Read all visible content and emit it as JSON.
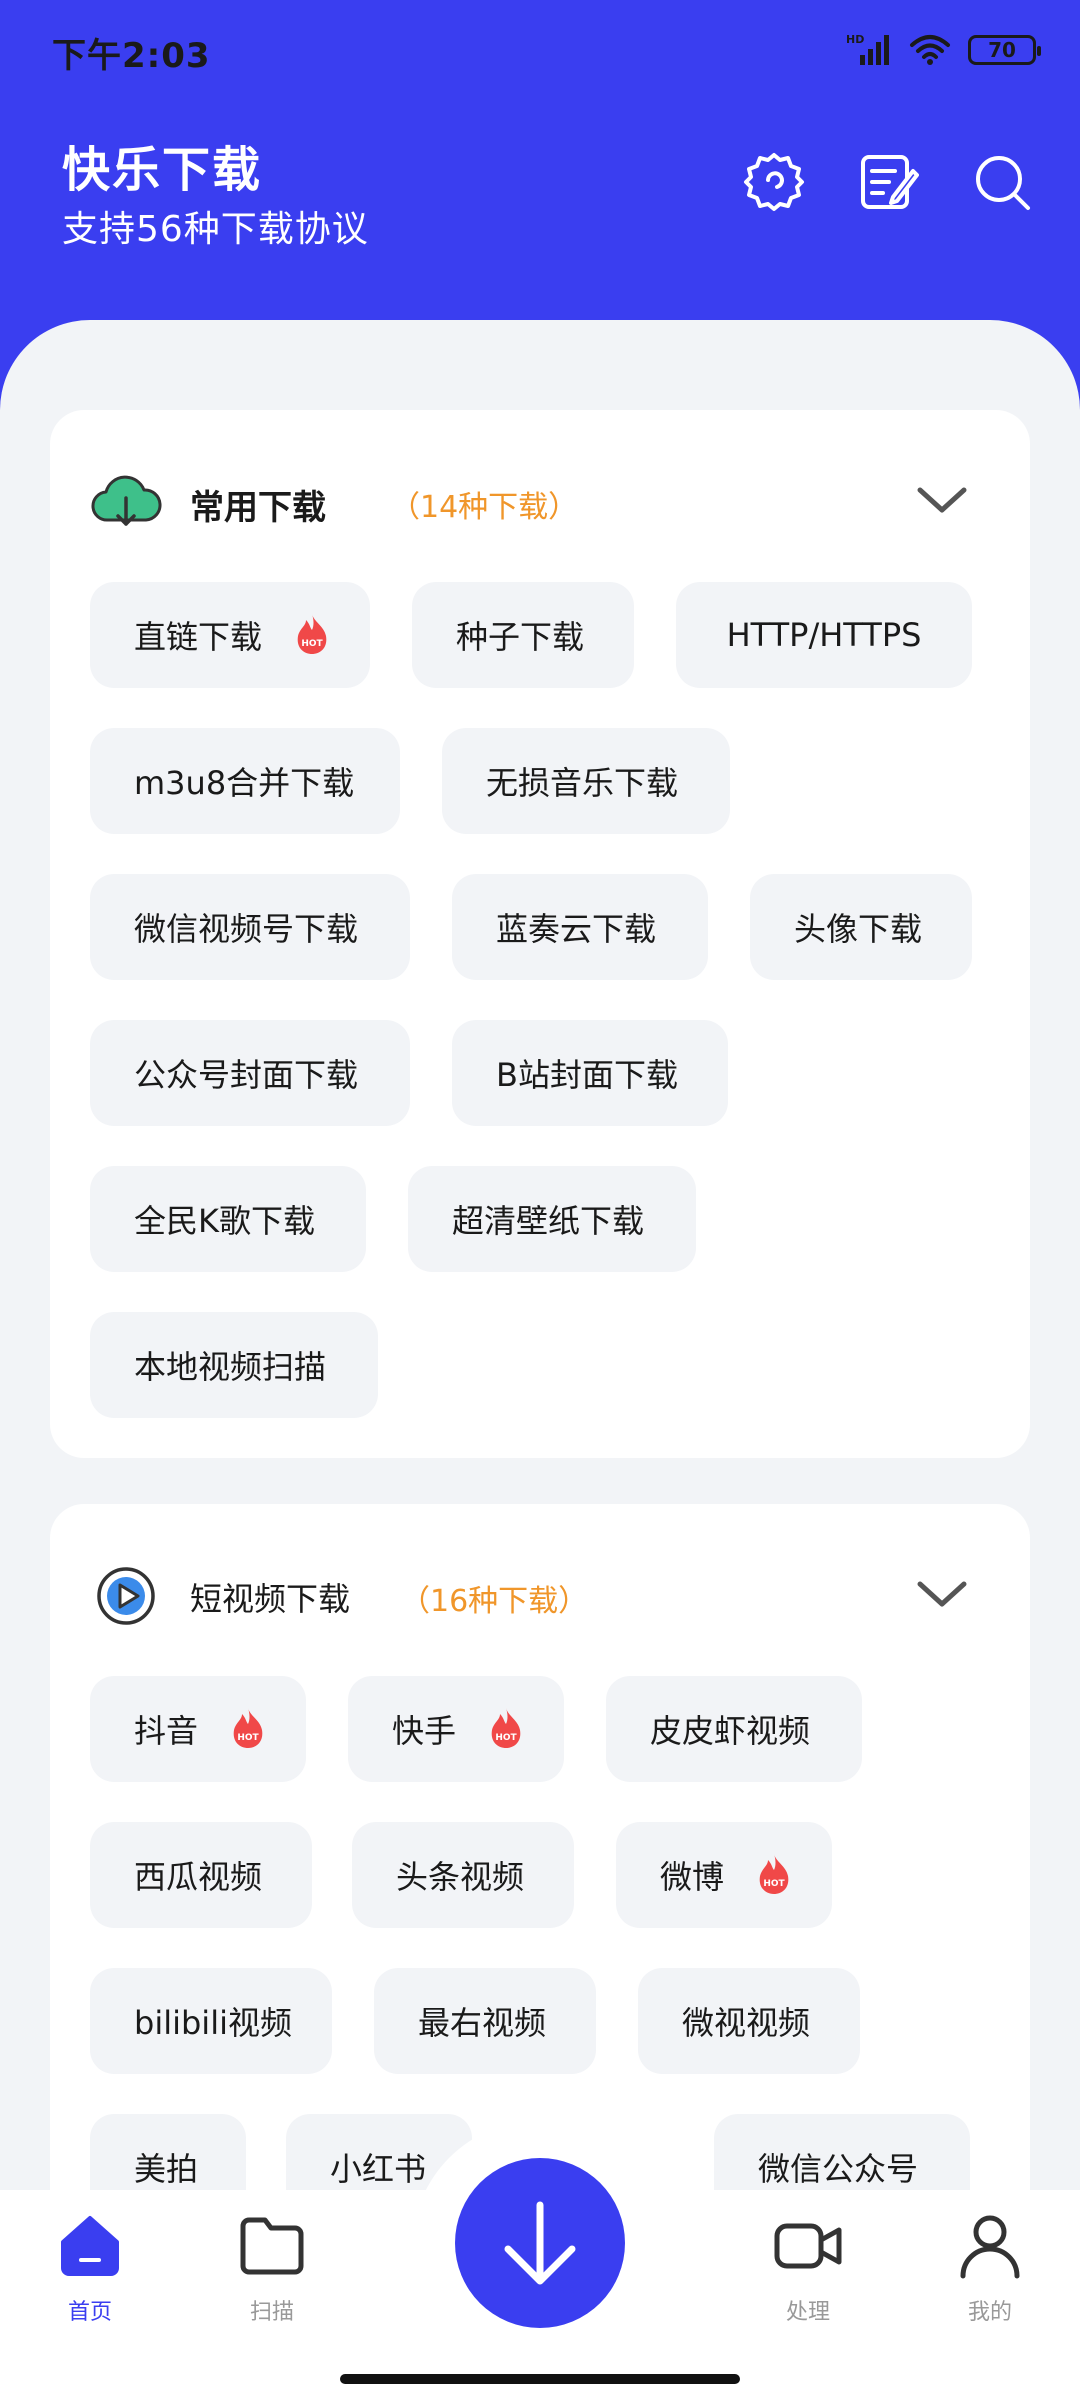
{
  "status": {
    "time": "下午2:03",
    "battery": "70",
    "network": "HD"
  },
  "header": {
    "title": "快乐下载",
    "subtitle": "支持56种下载协议"
  },
  "colors": {
    "brand": "#3a3ef0",
    "accent": "#f0962a",
    "chip_bg": "#f2f4f7",
    "hot": "#f04848"
  },
  "sections": [
    {
      "title": "常用下载",
      "count": "（14种下载）",
      "items": [
        {
          "label": "直链下载",
          "hot": true
        },
        {
          "label": "种子下载",
          "hot": false
        },
        {
          "label": "HTTP/HTTPS",
          "hot": false
        },
        {
          "label": "m3u8合并下载",
          "hot": false
        },
        {
          "label": "无损音乐下载",
          "hot": false
        },
        {
          "label": "微信视频号下载",
          "hot": false
        },
        {
          "label": "蓝奏云下载",
          "hot": false
        },
        {
          "label": "头像下载",
          "hot": false
        },
        {
          "label": "公众号封面下载",
          "hot": false
        },
        {
          "label": "B站封面下载",
          "hot": false
        },
        {
          "label": "全民K歌下载",
          "hot": false
        },
        {
          "label": "超清壁纸下载",
          "hot": false
        },
        {
          "label": "本地视频扫描",
          "hot": false
        }
      ]
    },
    {
      "title": "短视频下载",
      "count": "（16种下载）",
      "items": [
        {
          "label": "抖音",
          "hot": true
        },
        {
          "label": "快手",
          "hot": true
        },
        {
          "label": "皮皮虾视频",
          "hot": false
        },
        {
          "label": "西瓜视频",
          "hot": false
        },
        {
          "label": "头条视频",
          "hot": false
        },
        {
          "label": "微博",
          "hot": true
        },
        {
          "label": "bilibili视频",
          "hot": false
        },
        {
          "label": "最右视频",
          "hot": false
        },
        {
          "label": "微视视频",
          "hot": false
        },
        {
          "label": "美拍",
          "hot": false
        },
        {
          "label": "小红书",
          "hot": false
        },
        {
          "label": "微信公众号",
          "hot": false
        }
      ]
    }
  ],
  "hot_badge": "HOT",
  "nav": {
    "home": "首页",
    "scan": "扫描",
    "process": "处理",
    "mine": "我的"
  }
}
